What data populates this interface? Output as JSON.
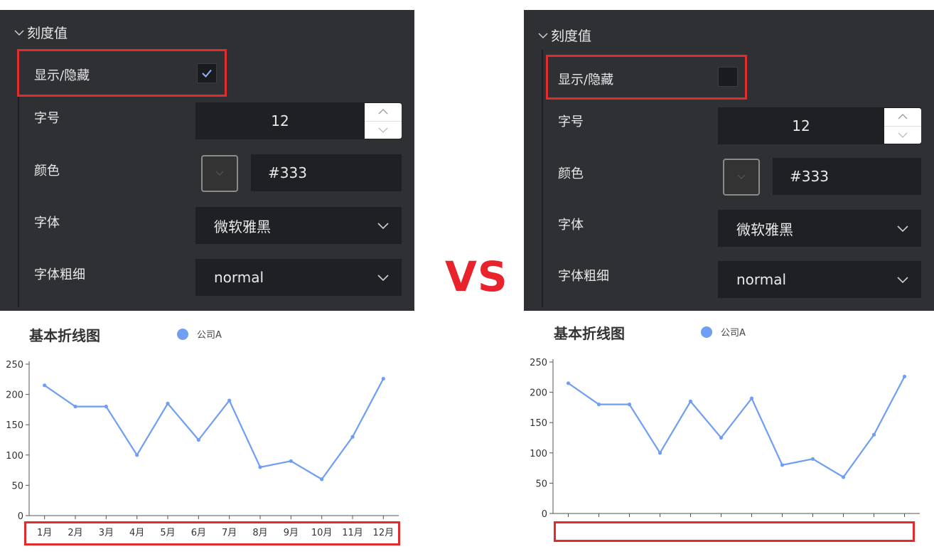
{
  "comparison_label": "VS",
  "left": {
    "section_title": "刻度值",
    "show_hide_label": "显示/隐藏",
    "show_hide_checked": true,
    "font_size_label": "字号",
    "font_size_value": "12",
    "color_label": "颜色",
    "color_value": "#333",
    "font_family_label": "字体",
    "font_family_value": "微软雅黑",
    "font_weight_label": "字体粗细",
    "font_weight_value": "normal"
  },
  "right": {
    "section_title": "刻度值",
    "show_hide_label": "显示/隐藏",
    "show_hide_checked": false,
    "font_size_label": "字号",
    "font_size_value": "12",
    "color_label": "颜色",
    "color_value": "#333",
    "font_family_label": "字体",
    "font_family_value": "微软雅黑",
    "font_weight_label": "字体粗细",
    "font_weight_value": "normal"
  },
  "colors": {
    "panel_bg": "#2f3033",
    "input_bg": "#1f2023",
    "highlight_red": "#e02c2c",
    "vs_red": "#e8232b",
    "series_blue": "#6f9ef2"
  },
  "chart_data": [
    {
      "type": "line",
      "title": "基本折线图",
      "legend": [
        "公司A"
      ],
      "legend_position": "top",
      "categories": [
        "1月",
        "2月",
        "3月",
        "4月",
        "5月",
        "6月",
        "7月",
        "8月",
        "9月",
        "10月",
        "11月",
        "12月"
      ],
      "show_x_tick_labels": true,
      "series": [
        {
          "name": "公司A",
          "values": [
            215,
            180,
            180,
            100,
            185,
            125,
            190,
            80,
            90,
            60,
            130,
            226
          ]
        }
      ],
      "yticks": [
        "0",
        "50",
        "100",
        "150",
        "200",
        "250"
      ],
      "ylim": [
        0,
        250
      ],
      "grid": false
    },
    {
      "type": "line",
      "title": "基本折线图",
      "legend": [
        "公司A"
      ],
      "legend_position": "top",
      "categories": [],
      "show_x_tick_labels": false,
      "series": [
        {
          "name": "公司A",
          "values": [
            215,
            180,
            180,
            100,
            185,
            125,
            190,
            80,
            90,
            60,
            130,
            226
          ]
        }
      ],
      "yticks": [
        "0",
        "50",
        "100",
        "150",
        "200",
        "250"
      ],
      "ylim": [
        0,
        250
      ],
      "grid": false
    }
  ]
}
